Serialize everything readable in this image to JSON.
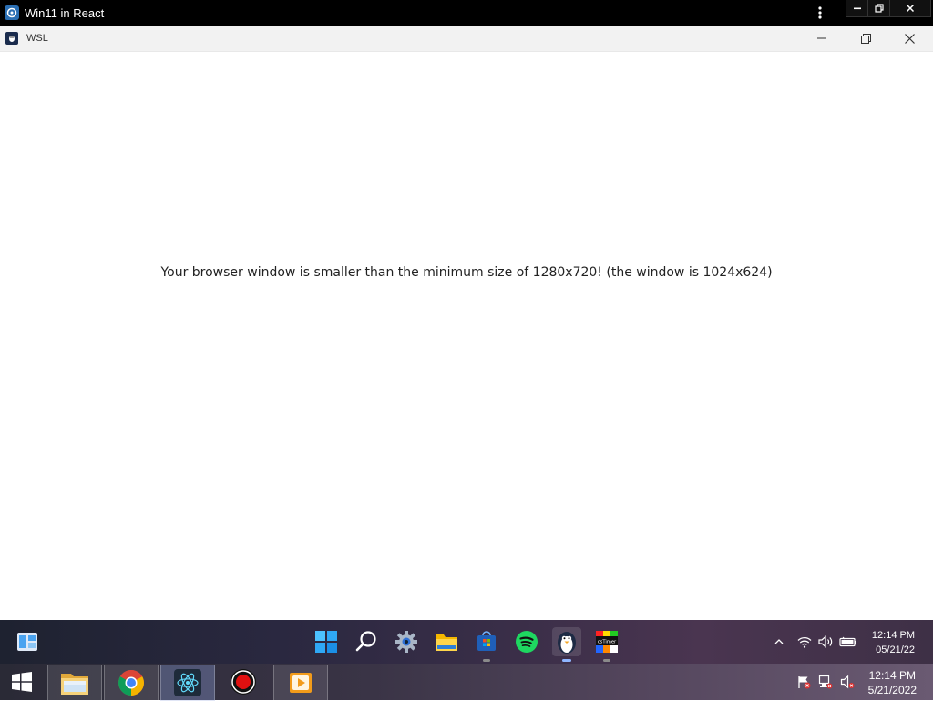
{
  "outer_window": {
    "title": "Win11 in React",
    "controls": [
      "minimize",
      "restore",
      "close"
    ]
  },
  "app_window": {
    "title": "WSL",
    "controls": [
      "minimize",
      "maximize",
      "close"
    ]
  },
  "content": {
    "message": "Your browser window is smaller than the minimum size of 1280x720! (the window is 1024x624)"
  },
  "taskbar": {
    "widgets_icon": "widgets-icon",
    "apps": [
      {
        "name": "start",
        "icon": "windows-start-icon"
      },
      {
        "name": "search",
        "icon": "search-icon"
      },
      {
        "name": "settings",
        "icon": "settings-gear-icon"
      },
      {
        "name": "file-explorer",
        "icon": "folder-icon"
      },
      {
        "name": "store",
        "icon": "store-icon"
      },
      {
        "name": "spotify",
        "icon": "spotify-icon"
      },
      {
        "name": "wsl",
        "icon": "penguin-icon",
        "active": true
      },
      {
        "name": "cstimer",
        "icon": "cstimer-icon"
      }
    ],
    "cstimer_label": "csTimer",
    "tray": {
      "chevron_icon": "chevron-up-icon",
      "wifi_icon": "wifi-icon",
      "volume_icon": "volume-icon",
      "battery_icon": "battery-icon"
    },
    "time": "12:14 PM",
    "date": "05/21/22"
  },
  "host_taskbar": {
    "apps": [
      {
        "name": "file-manager",
        "icon": "folder-icon"
      },
      {
        "name": "chrome",
        "icon": "chrome-icon"
      },
      {
        "name": "react",
        "icon": "react-icon"
      },
      {
        "name": "record",
        "icon": "record-icon"
      },
      {
        "name": "media-player",
        "icon": "media-player-icon"
      }
    ],
    "tray": {
      "flag_icon": "action-center-flag-icon",
      "network_icon": "network-icon",
      "volume_icon": "volume-muted-icon"
    },
    "time": "12:14 PM",
    "date": "5/21/2022"
  }
}
